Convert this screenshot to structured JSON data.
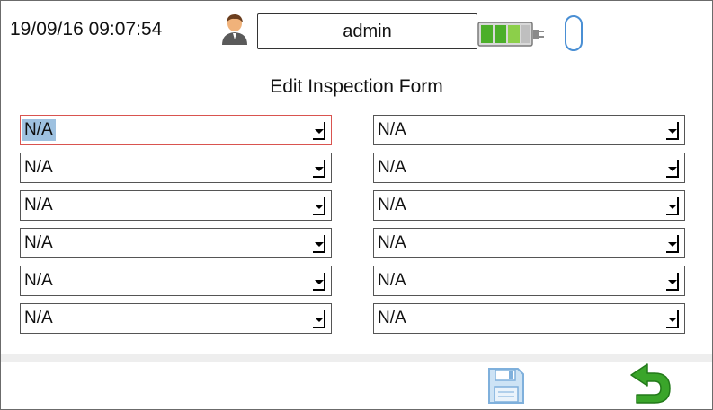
{
  "status_bar": {
    "datetime": "19/09/16 09:07:54",
    "username": "admin",
    "user_icon": "user-icon",
    "battery_icon": "battery-icon",
    "usb_icon": "usb-icon"
  },
  "form": {
    "title": "Edit Inspection Form",
    "left_fields": [
      {
        "value": "N/A"
      },
      {
        "value": "N/A"
      },
      {
        "value": "N/A"
      },
      {
        "value": "N/A"
      },
      {
        "value": "N/A"
      },
      {
        "value": "N/A"
      }
    ],
    "right_fields": [
      {
        "value": "N/A"
      },
      {
        "value": "N/A"
      },
      {
        "value": "N/A"
      },
      {
        "value": "N/A"
      },
      {
        "value": "N/A"
      },
      {
        "value": "N/A"
      }
    ]
  },
  "actions": {
    "save_icon": "floppy-disk-icon",
    "back_icon": "return-arrow-icon"
  },
  "colors": {
    "focus_border": "#d9534f",
    "selection_highlight": "#9ec1e0",
    "battery_green": "#4caf2a",
    "back_arrow_green": "#3aa52a"
  }
}
